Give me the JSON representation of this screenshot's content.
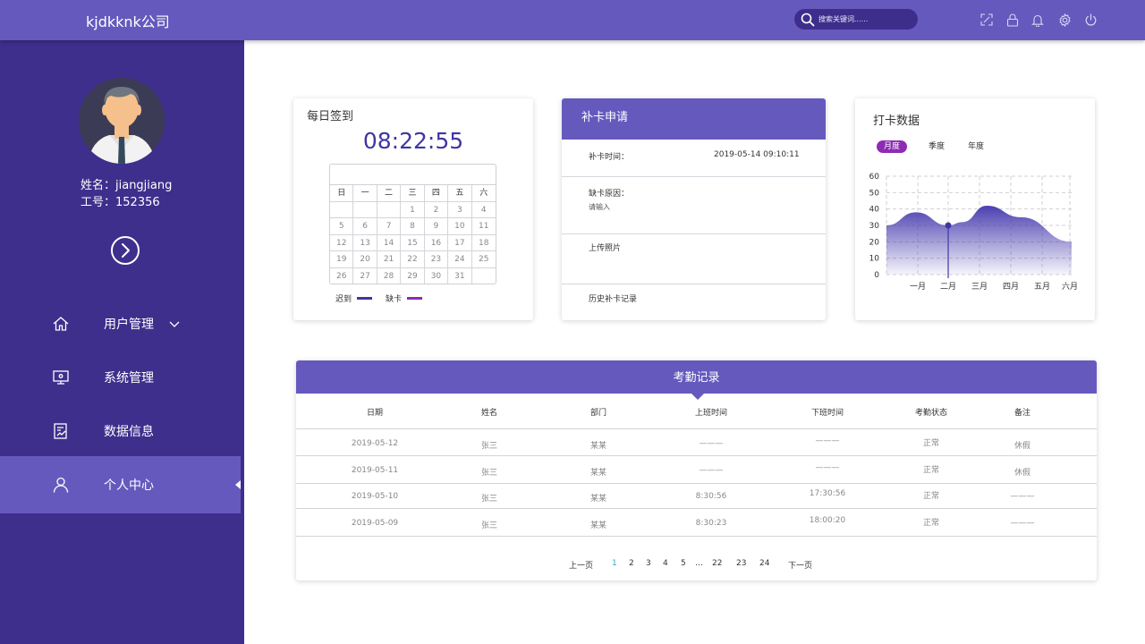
{
  "app": {
    "title": "kjdkknk公司",
    "search_placeholder": "搜索关键词......"
  },
  "header_icons": [
    "fullscreen-icon",
    "lock-icon",
    "bell-icon",
    "gear-icon",
    "power-icon"
  ],
  "user": {
    "name_line": "姓名：jiangjiang",
    "id_line": "工号：152356"
  },
  "nav": [
    {
      "label": "用户管理",
      "icon": "home-icon",
      "has_dropdown": true,
      "active": false
    },
    {
      "label": "系统管理",
      "icon": "monitor-icon",
      "active": false
    },
    {
      "label": "数据信息",
      "icon": "chart-doc-icon",
      "active": false
    },
    {
      "label": "个人中心",
      "icon": "person-icon",
      "active": true
    }
  ],
  "checkin": {
    "title": "每日签到",
    "time": "08:22:55",
    "weekdays": [
      "日",
      "一",
      "二",
      "三",
      "四",
      "五",
      "六"
    ],
    "days": [
      "",
      "",
      "",
      "1",
      "2",
      "3",
      "4",
      "5",
      "6",
      "7",
      "8",
      "9",
      "10",
      "11",
      "12",
      "13",
      "14",
      "15",
      "16",
      "17",
      "18",
      "19",
      "20",
      "21",
      "22",
      "23",
      "24",
      "25",
      "26",
      "27",
      "28",
      "29",
      "30",
      "31",
      "",
      ""
    ],
    "legend_late": "迟到",
    "legend_absent": "缺卡",
    "legend_late_color": "#3f36a3",
    "legend_absent_color": "#8e2bb5"
  },
  "supplement": {
    "title": "补卡申请",
    "time_label": "补卡时间：",
    "time_value": "2019-05-14  09:10:11",
    "reason_label": "缺卡原因：",
    "reason_placeholder": "请输入",
    "photo_label": "上传照片",
    "history_label": "历史补卡记录"
  },
  "stats": {
    "title": "打卡数据",
    "tabs": [
      "月度",
      "季度",
      "年度"
    ],
    "active_tab": "月度"
  },
  "chart_data": {
    "type": "area",
    "x": [
      "一月",
      "二月",
      "三月",
      "四月",
      "五月",
      "六月"
    ],
    "series": [
      {
        "values": [
          38,
          32,
          31,
          42,
          35,
          20
        ]
      }
    ],
    "highlight": {
      "x": "二月",
      "y": 30
    },
    "ylim": [
      0,
      60
    ],
    "yticks": [
      0,
      10,
      20,
      30,
      40,
      50,
      60
    ],
    "grid": true
  },
  "records": {
    "title": "考勤记录",
    "columns": [
      "日期",
      "姓名",
      "部门",
      "上班时间",
      "下班时间",
      "考勤状态",
      "备注"
    ],
    "rows": [
      [
        "2019-05-12",
        "张三",
        "某某",
        "———",
        "———",
        "正常",
        "休假"
      ],
      [
        "2019-05-11",
        "张三",
        "某某",
        "———",
        "———",
        "正常",
        "休假"
      ],
      [
        "2019-05-10",
        "张三",
        "某某",
        "8:30:56",
        "17:30:56",
        "正常",
        "———"
      ],
      [
        "2019-05-09",
        "张三",
        "某某",
        "8:30:23",
        "18:00:20",
        "正常",
        "———"
      ]
    ]
  },
  "pager": {
    "prev": "上一页",
    "pages": [
      "1",
      "2",
      "3",
      "4",
      "5",
      "…",
      "22",
      "23",
      "24"
    ],
    "current": "1",
    "next": "下一页"
  }
}
